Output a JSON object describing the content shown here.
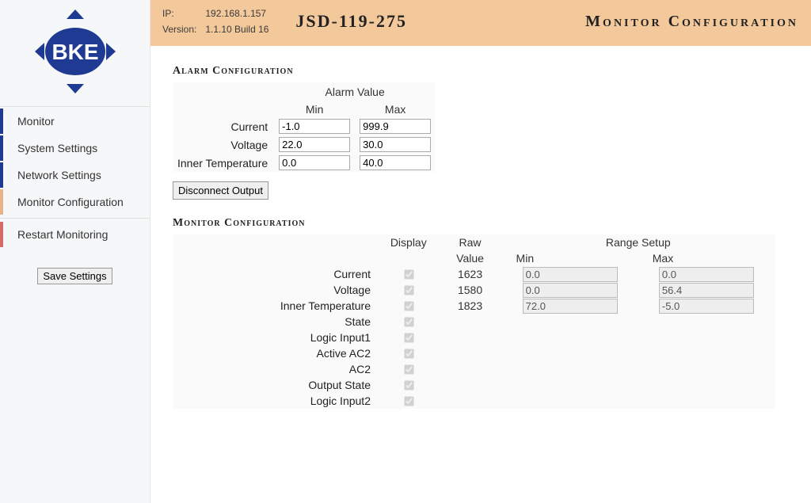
{
  "header": {
    "ip_label": "IP:",
    "ip_value": "192.168.1.157",
    "version_label": "Version:",
    "version_value": "1.1.10 Build 16",
    "model": "JSD-119-275",
    "page_title": "Monitor Configuration"
  },
  "sidebar": {
    "items": [
      {
        "label": "Monitor"
      },
      {
        "label": "System Settings"
      },
      {
        "label": "Network Settings"
      },
      {
        "label": "Monitor Configuration"
      },
      {
        "label": "Restart Monitoring"
      }
    ],
    "save_label": "Save Settings"
  },
  "alarm": {
    "title": "Alarm Configuration",
    "group_label": "Alarm Value",
    "col_min": "Min",
    "col_max": "Max",
    "rows": [
      {
        "label": "Current",
        "min": "-1.0",
        "max": "999.9"
      },
      {
        "label": "Voltage",
        "min": "22.0",
        "max": "30.0"
      },
      {
        "label": "Inner Temperature",
        "min": "0.0",
        "max": "40.0"
      }
    ],
    "disconnect_label": "Disconnect Output"
  },
  "monitor": {
    "title": "Monitor Configuration",
    "col_display": "Display",
    "col_raw": "Raw",
    "col_range": "Range Setup",
    "sub_value": "Value",
    "sub_min": "Min",
    "sub_max": "Max",
    "rows": [
      {
        "label": "Current",
        "display": true,
        "raw": "1623",
        "min": "0.0",
        "max": "0.0",
        "has_range": true
      },
      {
        "label": "Voltage",
        "display": true,
        "raw": "1580",
        "min": "0.0",
        "max": "56.4",
        "has_range": true
      },
      {
        "label": "Inner Temperature",
        "display": true,
        "raw": "1823",
        "min": "72.0",
        "max": "-5.0",
        "has_range": true
      },
      {
        "label": "State",
        "display": true,
        "has_range": false
      },
      {
        "label": "Logic Input1",
        "display": true,
        "has_range": false
      },
      {
        "label": "Active AC2",
        "display": true,
        "has_range": false
      },
      {
        "label": "AC2",
        "display": true,
        "has_range": false
      },
      {
        "label": "Output State",
        "display": true,
        "has_range": false
      },
      {
        "label": "Logic Input2",
        "display": true,
        "has_range": false
      }
    ]
  }
}
